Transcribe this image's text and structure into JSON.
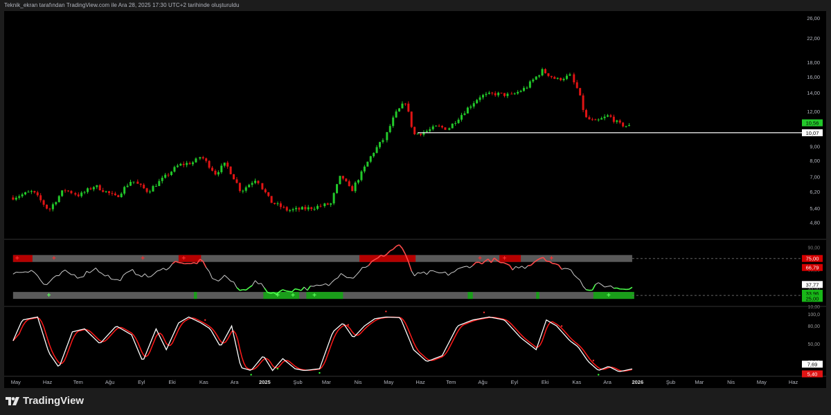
{
  "header": {
    "text": "Teknik_ekran tarafından TradingView.com ile Ara 28, 2025 17:30 UTC+2 tarihinde oluşturuldu"
  },
  "brand": {
    "name": "TradingView"
  },
  "colors": {
    "up": "#22c92a",
    "down": "#e01414",
    "bg": "#000000",
    "level": "#ffffff",
    "grid": "#2a2a2a"
  },
  "chart_data": [
    {
      "type": "candlestick",
      "title": "",
      "ylabel": "",
      "scale": "log",
      "ylim": [
        4.2,
        27.5
      ],
      "y_ticks": [
        {
          "v": 26,
          "label": "26,00"
        },
        {
          "v": 22,
          "label": "22,00"
        },
        {
          "v": 18,
          "label": "18,00"
        },
        {
          "v": 16,
          "label": "16,00"
        },
        {
          "v": 14,
          "label": "14,00"
        },
        {
          "v": 12,
          "label": "12,00"
        },
        {
          "v": 11,
          "label": "11,00"
        },
        {
          "v": 9,
          "label": "9,00"
        },
        {
          "v": 8,
          "label": "8,00"
        },
        {
          "v": 7,
          "label": "7,00"
        },
        {
          "v": 6.2,
          "label": "6,20"
        },
        {
          "v": 5.4,
          "label": "5,40"
        },
        {
          "v": 4.8,
          "label": "4,80"
        }
      ],
      "price_path": [
        [
          "2024-05-01",
          5.9
        ],
        [
          "2024-05-20",
          6.2
        ],
        [
          "2024-06-05",
          5.3
        ],
        [
          "2024-06-20",
          6.3
        ],
        [
          "2024-07-05",
          6.0
        ],
        [
          "2024-07-20",
          6.5
        ],
        [
          "2024-08-10",
          5.9
        ],
        [
          "2024-08-25",
          6.8
        ],
        [
          "2024-09-10",
          6.2
        ],
        [
          "2024-09-25",
          6.9
        ],
        [
          "2024-10-10",
          7.7
        ],
        [
          "2024-10-25",
          7.9
        ],
        [
          "2024-11-01",
          8.3
        ],
        [
          "2024-11-15",
          7.2
        ],
        [
          "2024-11-25",
          7.8
        ],
        [
          "2024-12-10",
          6.2
        ],
        [
          "2024-12-25",
          6.9
        ],
        [
          "2025-01-08",
          5.7
        ],
        [
          "2025-01-25",
          5.3
        ],
        [
          "2025-02-15",
          5.4
        ],
        [
          "2025-03-08",
          5.6
        ],
        [
          "2025-03-18",
          7.1
        ],
        [
          "2025-03-28",
          6.2
        ],
        [
          "2025-04-08",
          7.3
        ],
        [
          "2025-04-18",
          8.5
        ],
        [
          "2025-05-01",
          9.8
        ],
        [
          "2025-05-10",
          11.7
        ],
        [
          "2025-05-20",
          13.0
        ],
        [
          "2025-05-28",
          9.9
        ],
        [
          "2025-06-10",
          10.2
        ],
        [
          "2025-06-20",
          10.6
        ],
        [
          "2025-07-01",
          10.4
        ],
        [
          "2025-07-15",
          11.8
        ],
        [
          "2025-08-01",
          13.6
        ],
        [
          "2025-08-15",
          13.9
        ],
        [
          "2025-09-01",
          13.7
        ],
        [
          "2025-09-15",
          14.6
        ],
        [
          "2025-10-01",
          16.8
        ],
        [
          "2025-10-15",
          15.6
        ],
        [
          "2025-10-28",
          16.1
        ],
        [
          "2025-11-05",
          14.3
        ],
        [
          "2025-11-12",
          11.4
        ],
        [
          "2025-11-22",
          11.0
        ],
        [
          "2025-12-05",
          11.6
        ],
        [
          "2025-12-15",
          10.8
        ],
        [
          "2025-12-28",
          10.56
        ]
      ],
      "level_line": {
        "value": 10.07,
        "label": "10,07",
        "from": "2025-06-01"
      },
      "last_price": {
        "value": 10.56,
        "label": "10,56"
      }
    },
    {
      "type": "line",
      "indicator": "oscillator",
      "ylim": [
        12,
        100
      ],
      "levels": [
        {
          "v": 75.0,
          "label": "75,00"
        },
        {
          "v": 25.0,
          "label": "25,00"
        }
      ],
      "axis_labels": [
        {
          "v": 90,
          "label": "90,00"
        },
        {
          "v": 60,
          "label": "60,00"
        },
        {
          "v": 35,
          "label": "35,00"
        },
        {
          "v": 10,
          "label": "10,00"
        }
      ],
      "values_path": [
        [
          "2024-05-01",
          55
        ],
        [
          "2024-05-20",
          60
        ],
        [
          "2024-06-01",
          38
        ],
        [
          "2024-06-20",
          57
        ],
        [
          "2024-07-05",
          50
        ],
        [
          "2024-07-20",
          62
        ],
        [
          "2024-08-10",
          44
        ],
        [
          "2024-08-25",
          58
        ],
        [
          "2024-09-10",
          50
        ],
        [
          "2024-09-25",
          60
        ],
        [
          "2024-10-10",
          72
        ],
        [
          "2024-10-20",
          66
        ],
        [
          "2024-11-01",
          72
        ],
        [
          "2024-11-15",
          44
        ],
        [
          "2024-11-25",
          52
        ],
        [
          "2024-12-10",
          30
        ],
        [
          "2024-12-25",
          44
        ],
        [
          "2025-01-08",
          28
        ],
        [
          "2025-01-25",
          32
        ],
        [
          "2025-02-15",
          35
        ],
        [
          "2025-03-08",
          40
        ],
        [
          "2025-03-18",
          57
        ],
        [
          "2025-03-28",
          48
        ],
        [
          "2025-04-08",
          62
        ],
        [
          "2025-04-20",
          72
        ],
        [
          "2025-05-05",
          85
        ],
        [
          "2025-05-15",
          95
        ],
        [
          "2025-05-28",
          52
        ],
        [
          "2025-06-15",
          56
        ],
        [
          "2025-07-01",
          54
        ],
        [
          "2025-07-15",
          62
        ],
        [
          "2025-08-01",
          70
        ],
        [
          "2025-08-15",
          73
        ],
        [
          "2025-09-01",
          62
        ],
        [
          "2025-09-15",
          64
        ],
        [
          "2025-10-01",
          78
        ],
        [
          "2025-10-15",
          65
        ],
        [
          "2025-10-28",
          60
        ],
        [
          "2025-11-05",
          50
        ],
        [
          "2025-11-15",
          30
        ],
        [
          "2025-11-25",
          40
        ],
        [
          "2025-12-10",
          36
        ],
        [
          "2025-12-20",
          34
        ],
        [
          "2025-12-28",
          37.77
        ]
      ],
      "last_value": {
        "value": 37.77,
        "label": "37,77"
      },
      "signal": {
        "value": 66.79,
        "label": "66,79"
      },
      "lower_value": {
        "value": 33.96,
        "label": "33,96"
      },
      "bands_red": [
        [
          "2024-05-01",
          "2024-05-20"
        ],
        [
          "2024-10-10",
          "2024-11-01"
        ],
        [
          "2025-04-05",
          "2025-05-30"
        ],
        [
          "2025-08-20",
          "2025-09-10"
        ]
      ],
      "bands_green": [
        [
          "2024-10-25",
          "2024-10-28"
        ],
        [
          "2025-01-01",
          "2025-02-05"
        ],
        [
          "2025-02-12",
          "2025-03-20"
        ],
        [
          "2025-07-20",
          "2025-07-25"
        ],
        [
          "2025-09-25",
          "2025-09-28"
        ],
        [
          "2025-11-20",
          "2025-12-30"
        ]
      ],
      "markers_top": [
        "2024-05-05",
        "2024-06-10",
        "2024-09-05",
        "2024-10-15",
        "2025-08-01",
        "2025-08-25",
        "2025-10-10"
      ],
      "markers_bottom": [
        "2024-06-05",
        "2025-01-15",
        "2025-01-30",
        "2025-02-20",
        "2025-12-05"
      ]
    },
    {
      "type": "line",
      "indicator": "stochastic",
      "ylim": [
        0,
        100
      ],
      "axis_labels": [
        {
          "v": 100,
          "label": "100,0"
        },
        {
          "v": 80,
          "label": "80,00"
        },
        {
          "v": 50,
          "label": "50,00"
        },
        {
          "v": 20,
          "label": "20,00"
        }
      ],
      "k_path": [
        [
          "2024-05-01",
          55
        ],
        [
          "2024-05-10",
          90
        ],
        [
          "2024-05-25",
          95
        ],
        [
          "2024-06-05",
          35
        ],
        [
          "2024-06-15",
          10
        ],
        [
          "2024-06-28",
          70
        ],
        [
          "2024-07-10",
          75
        ],
        [
          "2024-07-25",
          50
        ],
        [
          "2024-08-10",
          80
        ],
        [
          "2024-08-25",
          65
        ],
        [
          "2024-09-05",
          20
        ],
        [
          "2024-09-18",
          75
        ],
        [
          "2024-09-28",
          40
        ],
        [
          "2024-10-10",
          85
        ],
        [
          "2024-10-20",
          95
        ],
        [
          "2024-11-01",
          85
        ],
        [
          "2024-11-10",
          75
        ],
        [
          "2024-11-20",
          45
        ],
        [
          "2024-12-01",
          80
        ],
        [
          "2024-12-10",
          10
        ],
        [
          "2024-12-20",
          5
        ],
        [
          "2025-01-01",
          30
        ],
        [
          "2025-01-10",
          5
        ],
        [
          "2025-01-20",
          25
        ],
        [
          "2025-02-01",
          8
        ],
        [
          "2025-02-10",
          5
        ],
        [
          "2025-02-25",
          8
        ],
        [
          "2025-03-10",
          70
        ],
        [
          "2025-03-20",
          85
        ],
        [
          "2025-03-30",
          60
        ],
        [
          "2025-04-10",
          80
        ],
        [
          "2025-04-20",
          92
        ],
        [
          "2025-05-01",
          95
        ],
        [
          "2025-05-15",
          94
        ],
        [
          "2025-05-28",
          40
        ],
        [
          "2025-06-10",
          20
        ],
        [
          "2025-06-25",
          30
        ],
        [
          "2025-07-10",
          80
        ],
        [
          "2025-07-25",
          90
        ],
        [
          "2025-08-10",
          95
        ],
        [
          "2025-08-25",
          90
        ],
        [
          "2025-09-10",
          60
        ],
        [
          "2025-09-25",
          40
        ],
        [
          "2025-10-05",
          90
        ],
        [
          "2025-10-15",
          80
        ],
        [
          "2025-10-28",
          55
        ],
        [
          "2025-11-05",
          45
        ],
        [
          "2025-11-15",
          20
        ],
        [
          "2025-11-25",
          5
        ],
        [
          "2025-12-05",
          12
        ],
        [
          "2025-12-15",
          3
        ],
        [
          "2025-12-28",
          7.69
        ]
      ],
      "k_last": {
        "value": 7.69,
        "label": "7,69"
      },
      "d_last": {
        "value": 5.4,
        "label": "5,40"
      },
      "markers_top": [
        "2024-11-05",
        "2025-03-25",
        "2025-05-01",
        "2025-08-05",
        "2025-10-20",
        "2025-11-20"
      ],
      "markers_bottom": [
        "2024-12-20",
        "2025-01-15",
        "2025-02-25",
        "2025-11-25"
      ]
    }
  ],
  "x_axis": {
    "labels": [
      {
        "date": "2024-05-01",
        "label": "May"
      },
      {
        "date": "2024-06-01",
        "label": "Haz"
      },
      {
        "date": "2024-07-01",
        "label": "Tem"
      },
      {
        "date": "2024-08-01",
        "label": "Ağu"
      },
      {
        "date": "2024-09-01",
        "label": "Eyl"
      },
      {
        "date": "2024-10-01",
        "label": "Eki"
      },
      {
        "date": "2024-11-01",
        "label": "Kas"
      },
      {
        "date": "2024-12-01",
        "label": "Ara"
      },
      {
        "date": "2025-01-01",
        "label": "2025",
        "bold": true
      },
      {
        "date": "2025-02-01",
        "label": "Şub"
      },
      {
        "date": "2025-03-01",
        "label": "Mar"
      },
      {
        "date": "2025-04-01",
        "label": "Nis"
      },
      {
        "date": "2025-05-01",
        "label": "May"
      },
      {
        "date": "2025-06-01",
        "label": "Haz"
      },
      {
        "date": "2025-07-01",
        "label": "Tem"
      },
      {
        "date": "2025-08-01",
        "label": "Ağu"
      },
      {
        "date": "2025-09-01",
        "label": "Eyl"
      },
      {
        "date": "2025-10-01",
        "label": "Eki"
      },
      {
        "date": "2025-11-01",
        "label": "Kas"
      },
      {
        "date": "2025-12-01",
        "label": "Ara"
      },
      {
        "date": "2026-01-01",
        "label": "2026",
        "bold": true
      },
      {
        "date": "2026-02-01",
        "label": "Şub"
      },
      {
        "date": "2026-03-01",
        "label": "Mar"
      },
      {
        "date": "2026-04-01",
        "label": "Nis"
      },
      {
        "date": "2026-05-01",
        "label": "May"
      },
      {
        "date": "2026-06-01",
        "label": "Haz"
      }
    ],
    "range": [
      "2024-04-25",
      "2026-06-25"
    ]
  }
}
